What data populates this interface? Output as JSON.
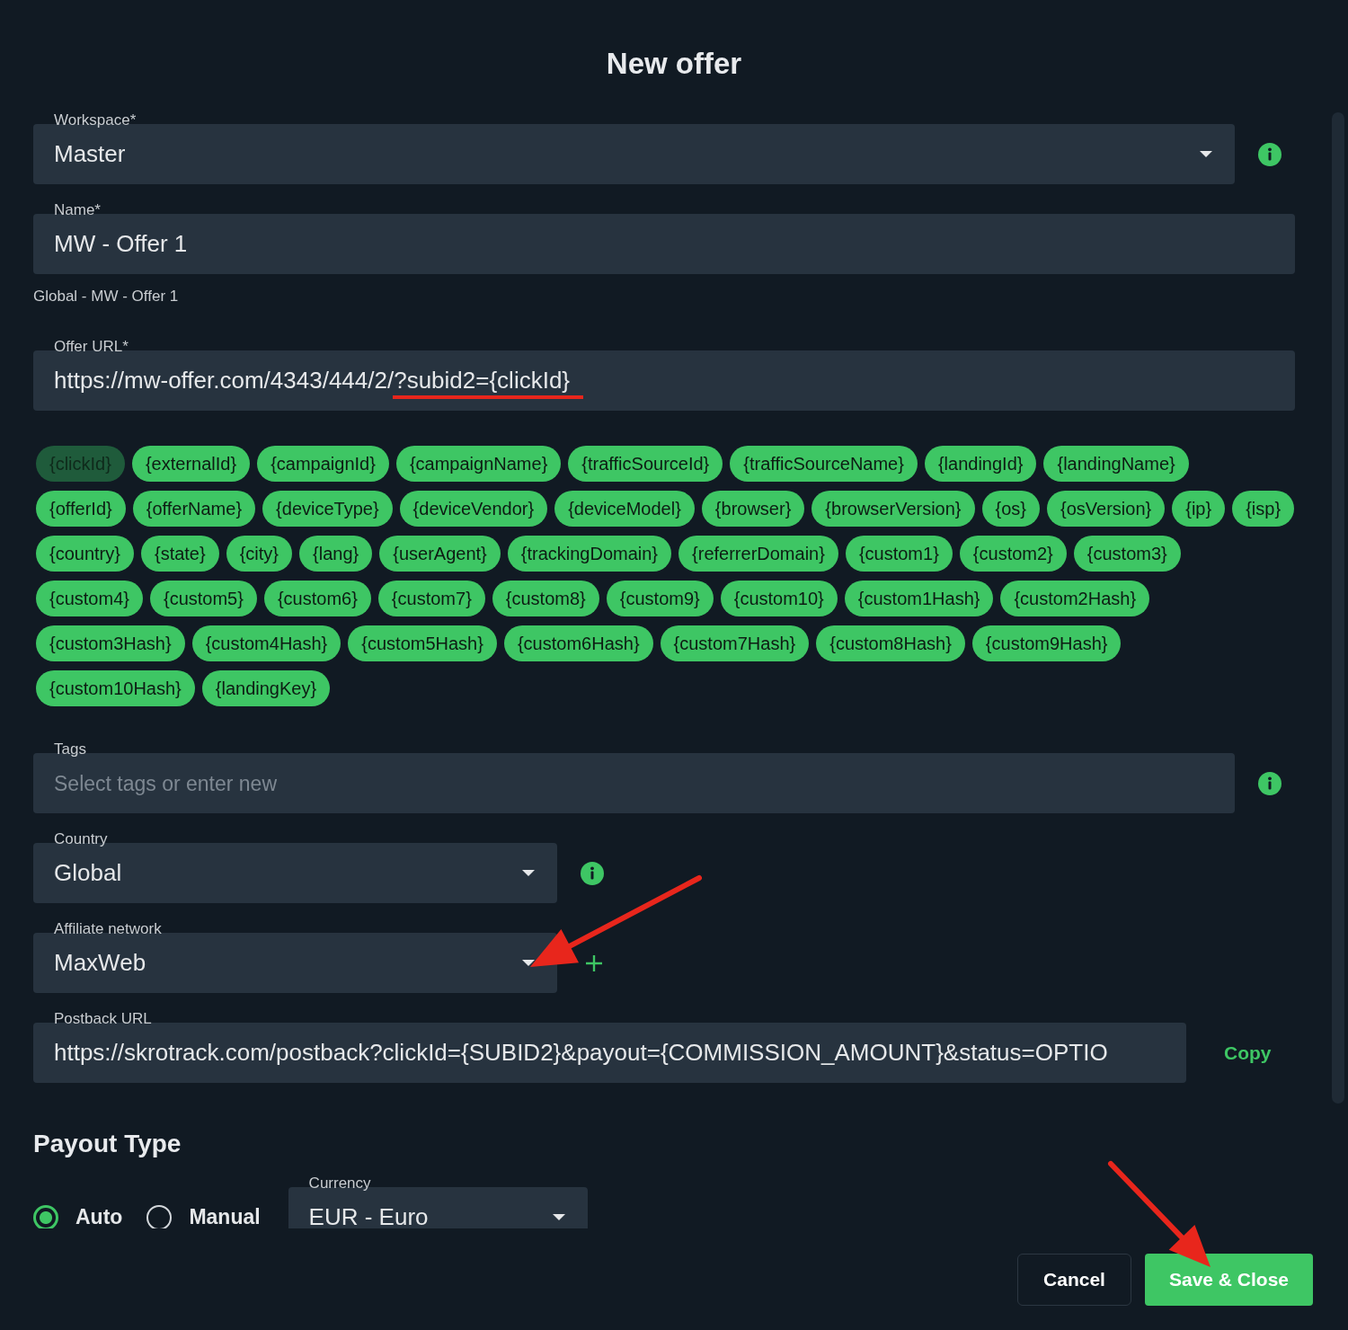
{
  "title": "New offer",
  "workspace": {
    "label": "Workspace*",
    "value": "Master"
  },
  "name": {
    "label": "Name*",
    "value": "MW - Offer 1",
    "hint": "Global - MW - Offer 1"
  },
  "offer_url": {
    "label": "Offer URL*",
    "value_parts": [
      {
        "text": "https://mw-offer.com/4343/444/2/",
        "underlined": false
      },
      {
        "text": "?subid2={clickId}",
        "underlined": true
      }
    ]
  },
  "token_rows": [
    [
      {
        "label": "{clickId}",
        "disabled": true
      },
      {
        "label": "{externalId}",
        "disabled": false
      },
      {
        "label": "{campaignId}",
        "disabled": false
      },
      {
        "label": "{campaignName}",
        "disabled": false
      },
      {
        "label": "{trafficSourceId}",
        "disabled": false
      },
      {
        "label": "{trafficSourceName}",
        "disabled": false
      },
      {
        "label": "{landingId}",
        "disabled": false
      },
      {
        "label": "{landingName}",
        "disabled": false
      }
    ],
    [
      {
        "label": "{offerId}",
        "disabled": false
      },
      {
        "label": "{offerName}",
        "disabled": false
      },
      {
        "label": "{deviceType}",
        "disabled": false
      },
      {
        "label": "{deviceVendor}",
        "disabled": false
      },
      {
        "label": "{deviceModel}",
        "disabled": false
      },
      {
        "label": "{browser}",
        "disabled": false
      },
      {
        "label": "{browserVersion}",
        "disabled": false
      },
      {
        "label": "{os}",
        "disabled": false
      },
      {
        "label": "{osVersion}",
        "disabled": false
      },
      {
        "label": "{ip}",
        "disabled": false
      },
      {
        "label": "{isp}",
        "disabled": false
      }
    ],
    [
      {
        "label": "{country}",
        "disabled": false
      },
      {
        "label": "{state}",
        "disabled": false
      },
      {
        "label": "{city}",
        "disabled": false
      },
      {
        "label": "{lang}",
        "disabled": false
      },
      {
        "label": "{userAgent}",
        "disabled": false
      },
      {
        "label": "{trackingDomain}",
        "disabled": false
      },
      {
        "label": "{referrerDomain}",
        "disabled": false
      },
      {
        "label": "{custom1}",
        "disabled": false
      },
      {
        "label": "{custom2}",
        "disabled": false
      },
      {
        "label": "{custom3}",
        "disabled": false
      }
    ],
    [
      {
        "label": "{custom4}",
        "disabled": false
      },
      {
        "label": "{custom5}",
        "disabled": false
      },
      {
        "label": "{custom6}",
        "disabled": false
      },
      {
        "label": "{custom7}",
        "disabled": false
      },
      {
        "label": "{custom8}",
        "disabled": false
      },
      {
        "label": "{custom9}",
        "disabled": false
      },
      {
        "label": "{custom10}",
        "disabled": false
      },
      {
        "label": "{custom1Hash}",
        "disabled": false
      },
      {
        "label": "{custom2Hash}",
        "disabled": false
      }
    ],
    [
      {
        "label": "{custom3Hash}",
        "disabled": false
      },
      {
        "label": "{custom4Hash}",
        "disabled": false
      },
      {
        "label": "{custom5Hash}",
        "disabled": false
      },
      {
        "label": "{custom6Hash}",
        "disabled": false
      },
      {
        "label": "{custom7Hash}",
        "disabled": false
      },
      {
        "label": "{custom8Hash}",
        "disabled": false
      },
      {
        "label": "{custom9Hash}",
        "disabled": false
      }
    ],
    [
      {
        "label": "{custom10Hash}",
        "disabled": false
      },
      {
        "label": "{landingKey}",
        "disabled": false
      }
    ]
  ],
  "tags": {
    "label": "Tags",
    "placeholder": "Select tags or enter new"
  },
  "country": {
    "label": "Country",
    "value": "Global"
  },
  "affiliate_network": {
    "label": "Affiliate network",
    "value": "MaxWeb"
  },
  "postback_url": {
    "label": "Postback URL",
    "value": "https://skrotrack.com/postback?clickId={SUBID2}&payout={COMMISSION_AMOUNT}&status=OPTIO",
    "copy": "Copy"
  },
  "payout_type": {
    "title": "Payout Type",
    "options": [
      {
        "label": "Auto",
        "selected": true
      },
      {
        "label": "Manual",
        "selected": false
      }
    ]
  },
  "currency": {
    "label": "Currency",
    "value": "EUR - Euro"
  },
  "buttons": [
    {
      "label": "Cancel",
      "kind": "secondary"
    },
    {
      "label": "Save & Close",
      "kind": "primary"
    }
  ]
}
